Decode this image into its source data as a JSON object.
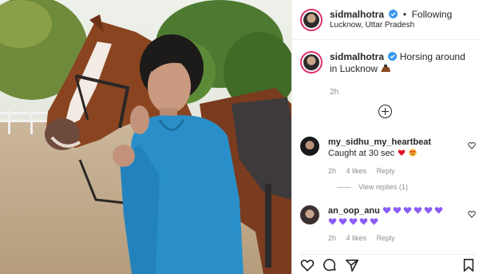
{
  "post": {
    "username": "sidmalhotra",
    "follow_status": "Following",
    "location": "Lucknow, Uttar Pradesh",
    "caption_text": "Horsing around in Lucknow",
    "caption_emoji_icon": "horse-rider-emoji-icon",
    "time": "2h"
  },
  "comments": [
    {
      "username": "my_sidhu_my_heartbeat",
      "text": "Caught at 30 sec",
      "emoji_icons": [
        "red-heart-icon",
        "heart-eyes-face-icon"
      ],
      "time": "2h",
      "likes": "4 likes",
      "reply_label": "Reply",
      "view_replies": "View replies (1)"
    },
    {
      "username": "an_oop_anu",
      "text": "",
      "purple_heart_count": 11,
      "time": "2h",
      "likes": "4 likes",
      "reply_label": "Reply"
    }
  ],
  "icons": [
    "verified-badge-icon",
    "add-comment-plus-icon",
    "like-heart-icon",
    "comment-icon",
    "share-icon",
    "save-bookmark-icon"
  ],
  "colors": {
    "verified_blue": "#3897f0",
    "story_ring": "#e1306c",
    "secondary_text": "#8e8e8e",
    "purple_heart": "#8a5cf5",
    "red_heart": "#e0162b",
    "hoodie_blue": "#2a8fc9"
  }
}
